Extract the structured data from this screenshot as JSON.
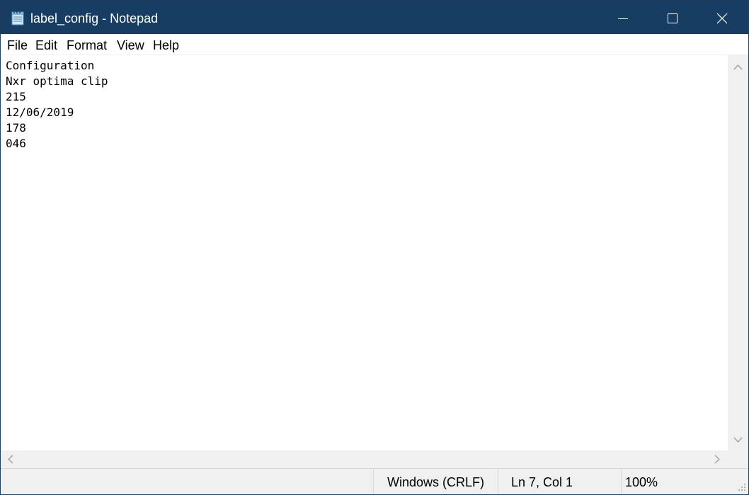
{
  "window": {
    "title": "label_config - Notepad",
    "app_icon": "notepad-icon",
    "controls": {
      "minimize_icon": "minimize-icon",
      "maximize_icon": "maximize-icon",
      "close_icon": "close-icon"
    }
  },
  "menu": {
    "items": [
      {
        "label": "File"
      },
      {
        "label": "Edit"
      },
      {
        "label": "Format"
      },
      {
        "label": "View"
      },
      {
        "label": "Help"
      }
    ]
  },
  "editor": {
    "lines": [
      "Configuration",
      "Nxr optima clip",
      "215",
      "12/06/2019",
      "178",
      "046"
    ]
  },
  "status": {
    "encoding": "Windows (CRLF)",
    "position": "Ln 7, Col 1",
    "zoom": "100%"
  },
  "colors": {
    "titlebar": "#173d63",
    "chrome": "#f0f0f0",
    "text": "#000000"
  }
}
